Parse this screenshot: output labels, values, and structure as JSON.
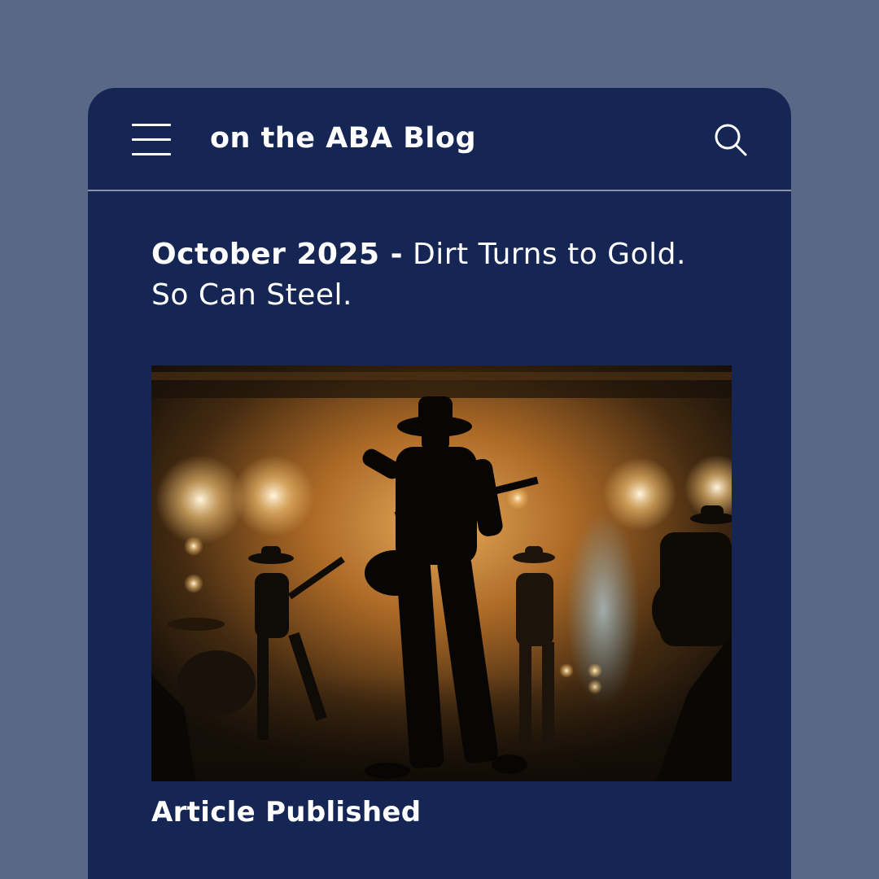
{
  "header": {
    "title": "on the ABA Blog",
    "menu_icon": "hamburger-menu-icon",
    "search_icon": "search-icon"
  },
  "post": {
    "date": "October 2025 -",
    "title_line1": "Dirt Turns to Gold.",
    "title_line2": "So Can Steel.",
    "image_description": "Silhouetted cowboy band with guitars on a smoky stage under warm stage lights",
    "caption": "Article Published"
  },
  "colors": {
    "page_background": "#5a6888",
    "card_background": "#152654",
    "text": "#ffffff",
    "divider": "#8a93a8",
    "stage_glow": "#e0922f"
  }
}
